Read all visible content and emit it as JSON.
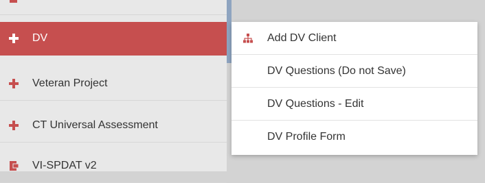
{
  "sidebar": {
    "items": [
      {
        "label": "",
        "icon": "form-icon",
        "cut": true
      },
      {
        "label": "DV",
        "icon": "plus-icon",
        "active": true
      },
      {
        "label": "Veteran Project",
        "icon": "plus-icon"
      },
      {
        "label": "CT Universal Assessment",
        "icon": "plus-icon"
      },
      {
        "label": "VI-SPDAT v2",
        "icon": "form-icon"
      }
    ]
  },
  "flyout": {
    "items": [
      {
        "label": "Add DV Client",
        "icon": "sitemap-icon"
      },
      {
        "label": "DV Questions (Do not Save)"
      },
      {
        "label": "DV Questions - Edit"
      },
      {
        "label": "DV Profile Form"
      }
    ]
  },
  "colors": {
    "accent": "#c64f4f",
    "sidebar_bg": "#e8e8e8",
    "page_bg": "#d3d3d3",
    "scroll_thumb": "#8ea4c0"
  }
}
